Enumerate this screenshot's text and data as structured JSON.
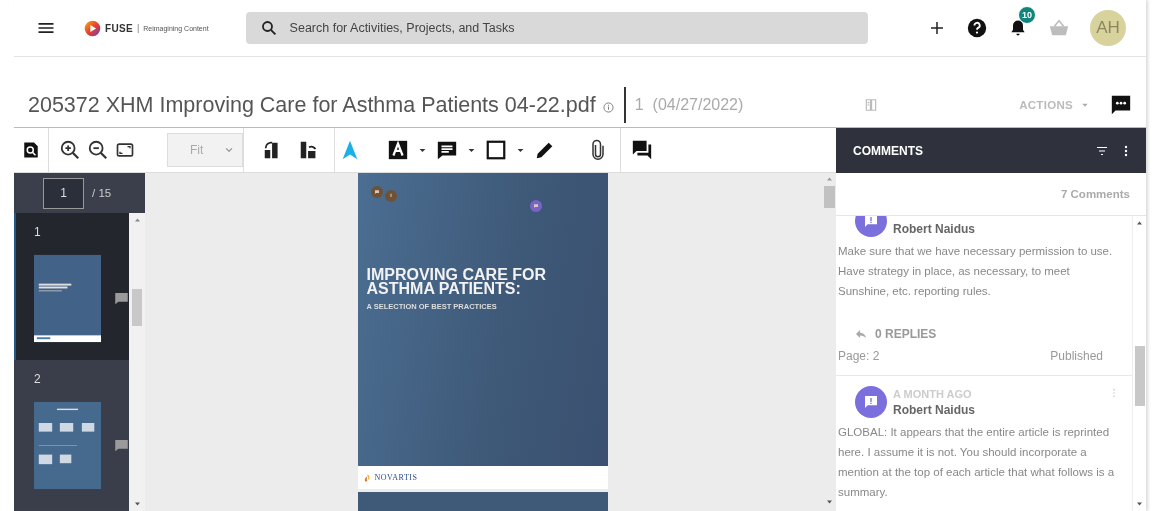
{
  "header": {
    "logo": {
      "name": "FUSE",
      "separator": "|",
      "tagline": "Reimagining Content"
    },
    "search": {
      "placeholder": "Search for Activities, Projects, and Tasks"
    },
    "notifications": {
      "count": "10"
    },
    "avatar": {
      "initials": "AH"
    }
  },
  "document": {
    "title": "205372 XHM Improving Care for Asthma Patients 04-22.pdf",
    "version": "1",
    "date": "(04/27/2022)",
    "actions": "ACTIONS"
  },
  "toolbar": {
    "zoom": "Fit"
  },
  "thumbnails": {
    "page": "1",
    "total": "/ 15",
    "pages": [
      {
        "label": "1",
        "selected": true,
        "kind": "cover"
      },
      {
        "label": "2",
        "selected": false,
        "kind": "grid"
      }
    ]
  },
  "page": {
    "headline": "IMPROVING CARE FOR ASTHMA PATIENTS:",
    "subtitle": "A SELECTION OF BEST PRACTICES",
    "brand": "NOVARTIS",
    "markers": [
      {
        "kind": "comment",
        "color": "#6e5238"
      },
      {
        "kind": "attachment",
        "color": "#6e5238"
      },
      {
        "kind": "comment",
        "color": "#7b62c9"
      }
    ]
  },
  "comments": {
    "title": "COMMENTS",
    "count": "7 Comments",
    "items": [
      {
        "author": "Robert Naidus",
        "text": "Make sure that we have necessary permission to use. Have strategy in place, as necessary, to meet Sunshine, etc. reporting rules.",
        "replies": "0 REPLIES",
        "page": "Page: 2",
        "status": "Published"
      },
      {
        "time": "A MONTH AGO",
        "author": "Robert Naidus",
        "text": "GLOBAL: It appears that the entire article is reprinted here. I assume it is not. You should incorporate a mention at the top of each article that what follows is a summary."
      }
    ]
  }
}
